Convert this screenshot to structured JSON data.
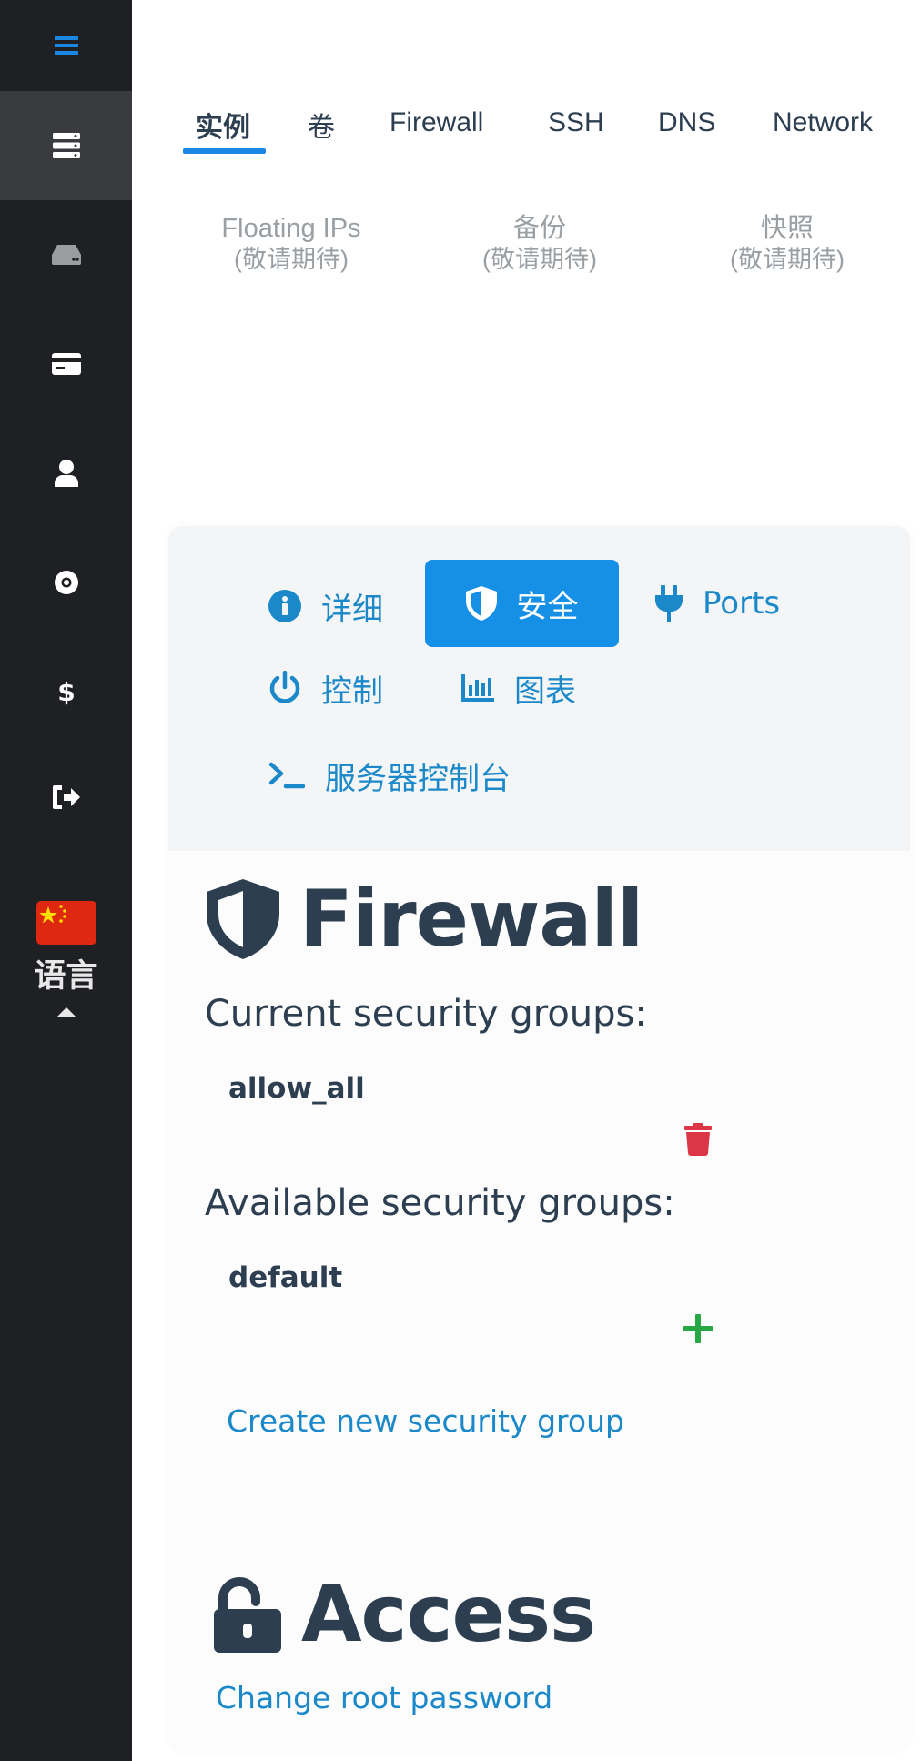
{
  "sidebar": {
    "items": [
      {
        "icon": "hamburger-menu-icon"
      },
      {
        "icon": "server-icon",
        "active": true
      },
      {
        "icon": "hard-drive-icon"
      },
      {
        "icon": "credit-card-icon"
      },
      {
        "icon": "user-icon"
      },
      {
        "icon": "life-ring-icon"
      },
      {
        "icon": "dollar-icon"
      },
      {
        "icon": "sign-out-icon"
      }
    ],
    "language": {
      "flag": "china-flag",
      "label": "语言"
    },
    "accent_color": "#1a88e3",
    "bg_color": "#1f2024"
  },
  "tabs": [
    {
      "label": "实例",
      "active": true
    },
    {
      "label": "卷"
    },
    {
      "label": "Firewall"
    },
    {
      "label": "SSH"
    },
    {
      "label": "DNS"
    },
    {
      "label": "Network"
    }
  ],
  "coming_soon": [
    {
      "title": "Floating IPs",
      "note": "(敬请期待)"
    },
    {
      "title": "备份",
      "note": "(敬请期待)"
    },
    {
      "title": "快照",
      "note": "(敬请期待)"
    }
  ],
  "card_nav": [
    {
      "label": "详细",
      "icon": "info-icon"
    },
    {
      "label": "安全",
      "icon": "shield-icon",
      "active": true
    },
    {
      "label": "Ports",
      "icon": "plug-icon"
    },
    {
      "label": "控制",
      "icon": "power-icon"
    },
    {
      "label": "图表",
      "icon": "chart-bar-icon"
    },
    {
      "label": "服务器控制台",
      "icon": "terminal-icon"
    }
  ],
  "firewall": {
    "title": "Firewall",
    "current_label": "Current security groups:",
    "current_groups": [
      "allow_all"
    ],
    "available_label": "Available security groups:",
    "available_groups": [
      "default"
    ],
    "create_link": "Create new security group",
    "delete_color": "#dc3545",
    "add_color": "#28a745"
  },
  "access": {
    "title": "Access",
    "change_password_link": "Change root password"
  }
}
